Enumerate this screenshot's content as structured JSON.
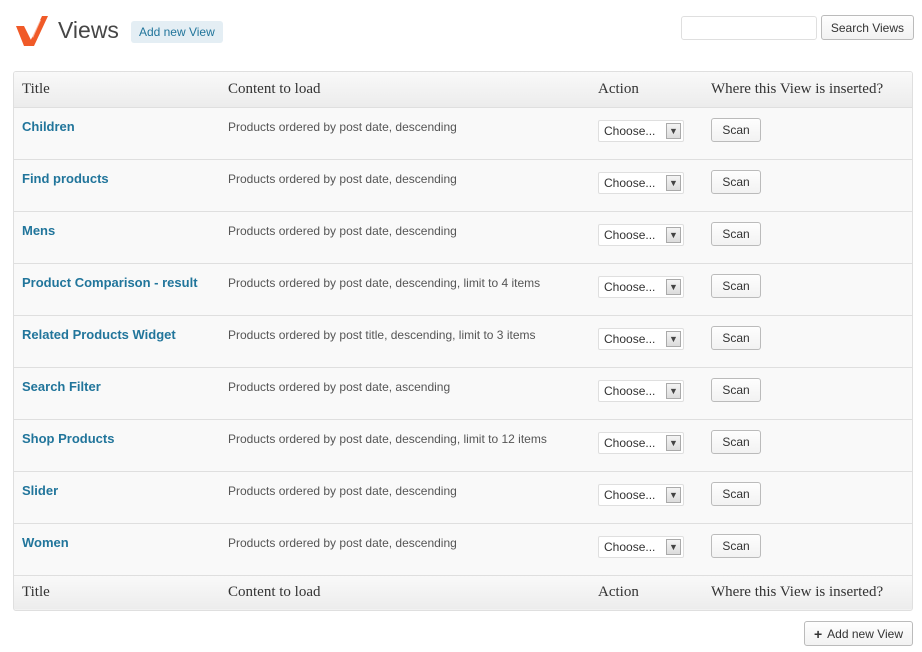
{
  "header": {
    "title": "Views",
    "add_new_label": "Add new View",
    "logo_icon": "views-logo-icon"
  },
  "search": {
    "value": "",
    "placeholder": "",
    "button_label": "Search Views"
  },
  "table": {
    "columns": [
      "Title",
      "Content to load",
      "Action",
      "Where this View is inserted?"
    ],
    "rows": [
      {
        "title": "Children",
        "content": "Products ordered by post date, descending",
        "action": "Choose...",
        "scan": "Scan"
      },
      {
        "title": "Find products",
        "content": "Products ordered by post date, descending",
        "action": "Choose...",
        "scan": "Scan"
      },
      {
        "title": "Mens",
        "content": "Products ordered by post date, descending",
        "action": "Choose...",
        "scan": "Scan"
      },
      {
        "title": "Product Comparison - result",
        "content": "Products ordered by post date, descending, limit to 4 items",
        "action": "Choose...",
        "scan": "Scan"
      },
      {
        "title": "Related Products Widget",
        "content": "Products ordered by post title, descending, limit to 3 items",
        "action": "Choose...",
        "scan": "Scan"
      },
      {
        "title": "Search Filter",
        "content": "Products ordered by post date, ascending",
        "action": "Choose...",
        "scan": "Scan"
      },
      {
        "title": "Shop Products",
        "content": "Products ordered by post date, descending, limit to 12 items",
        "action": "Choose...",
        "scan": "Scan"
      },
      {
        "title": "Slider",
        "content": "Products ordered by post date, descending",
        "action": "Choose...",
        "scan": "Scan"
      },
      {
        "title": "Women",
        "content": "Products ordered by post date, descending",
        "action": "Choose...",
        "scan": "Scan"
      }
    ]
  },
  "footer": {
    "add_new_label": "Add new View",
    "plus_icon": "plus-icon"
  },
  "colors": {
    "link": "#21759b",
    "logo_orange": "#f05a28"
  }
}
